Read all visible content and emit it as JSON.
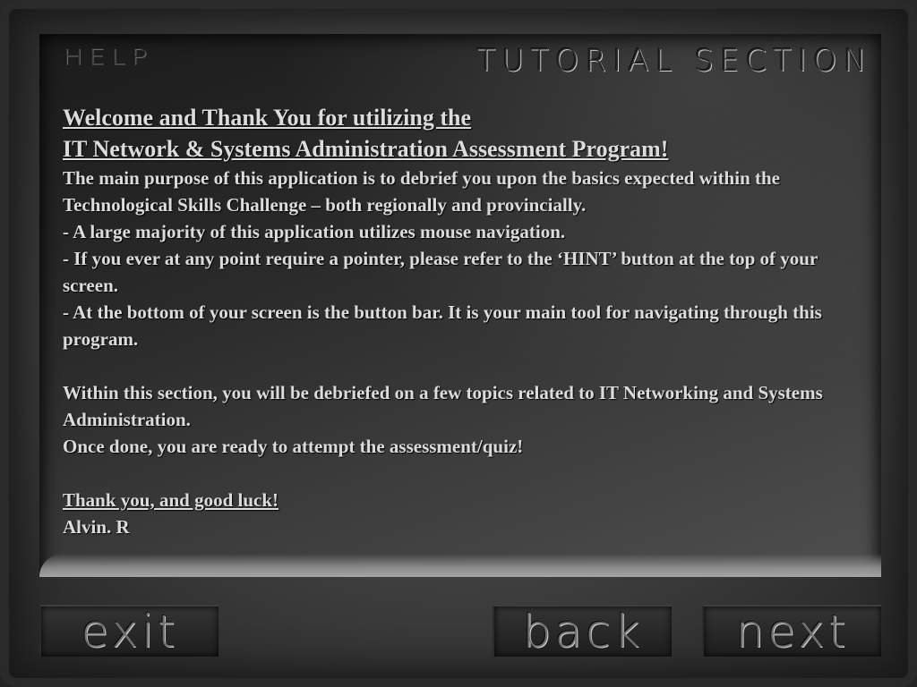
{
  "header": {
    "help_label": "HELP",
    "section_title": "TUTORIAL SECTION"
  },
  "content": {
    "heading_line1": "Welcome and Thank You for utilizing the",
    "heading_line2": "IT Network & Systems Administration Assessment Program!",
    "paragraph1": "The main purpose of this application is to debrief you upon the basics expected within the Technological Skills Challenge – both regionally and provincially.\n- A large majority of this application utilizes mouse navigation.\n- If you ever at any point require a pointer, please refer to the ‘HINT’ button at the top of your screen.\n- At the bottom of your screen is the button bar. It is your main tool for navigating through this program.",
    "paragraph2": "Within this section, you will be debriefed on a few topics related to IT Networking and Systems Administration.\nOnce done, you are ready to attempt the assessment/quiz!",
    "closing": "Thank you, and good luck!",
    "author": "Alvin. R"
  },
  "buttons": {
    "exit_label": "exit",
    "back_label": "back",
    "next_label": "next"
  }
}
